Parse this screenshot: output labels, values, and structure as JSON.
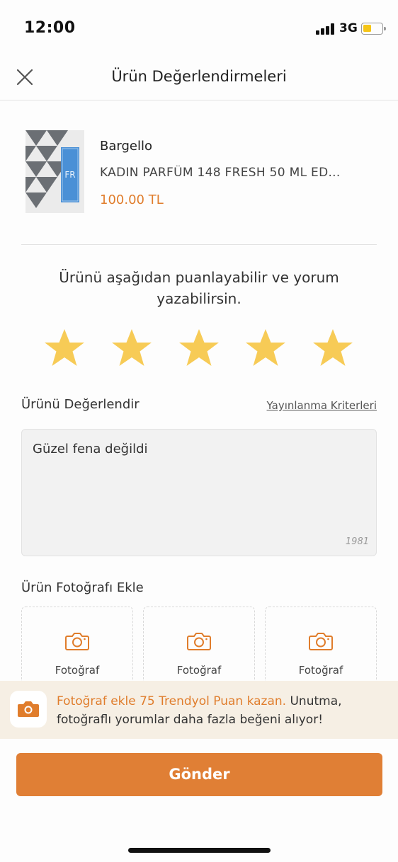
{
  "status_bar": {
    "time": "12:00",
    "network": "3G",
    "battery_color": "#f5c518"
  },
  "header": {
    "title": "Ürün Değerlendirmeleri",
    "close_icon": "close-icon"
  },
  "product": {
    "brand": "Bargello",
    "name": "KADIN PARFÜM 148 FRESH 50 ML ED...",
    "price": "100.00 TL",
    "image_label": "FR",
    "price_color": "#e07d2c"
  },
  "rating": {
    "prompt": "Ürünü aşağıdan puanlayabilir ve yorum yazabilirsin.",
    "stars_selected": 5,
    "stars_total": 5,
    "star_color": "#f7cb56"
  },
  "review": {
    "label": "Ürünü Değerlendir",
    "criteria_link": "Yayınlanma Kriterleri",
    "text": "Güzel fena değildi",
    "remaining_chars": "1981"
  },
  "photos": {
    "label": "Ürün Fotoğrafı Ekle",
    "slots": [
      {
        "label": "Fotoğraf",
        "icon": "camera-icon"
      },
      {
        "label": "Fotoğraf",
        "icon": "camera-icon"
      },
      {
        "label": "Fotoğraf",
        "icon": "camera-icon"
      }
    ]
  },
  "promo": {
    "highlight": "Fotoğraf ekle 75 Trendyol Puan kazan.",
    "text": " Unutma, fotoğraflı yorumlar daha fazla beğeni alıyor!",
    "icon": "camera-icon"
  },
  "submit": {
    "label": "Gönder",
    "color": "#e07f35"
  }
}
